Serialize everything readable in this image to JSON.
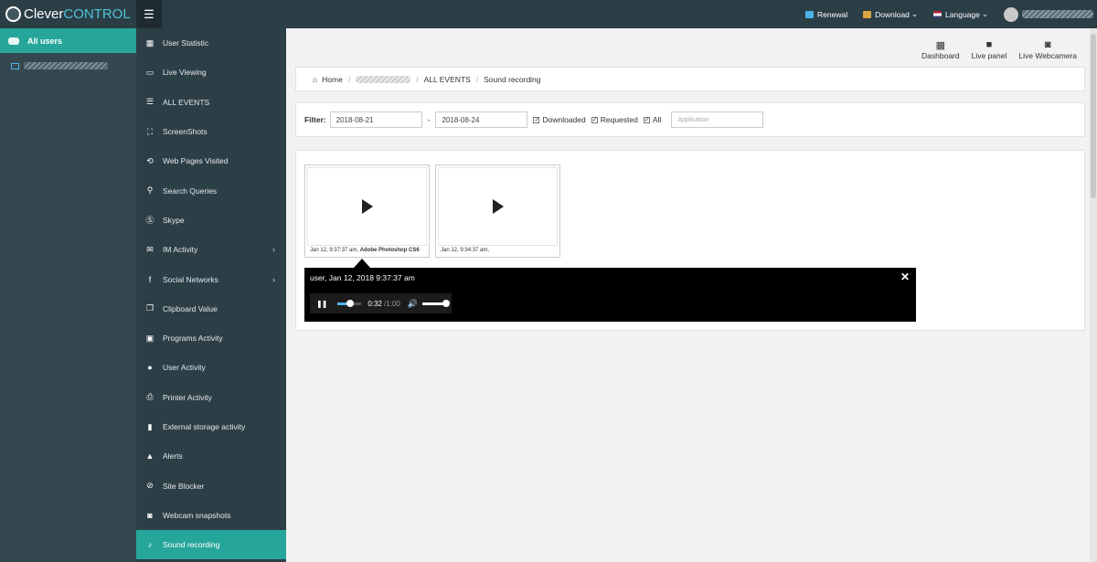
{
  "app": {
    "brand_a": "Clever",
    "brand_b": "CONTROL"
  },
  "topbar": {
    "renewal": "Renewal",
    "download": "Download",
    "language": "Language",
    "caret": "⌄"
  },
  "sidebar": {
    "all_users": "All users"
  },
  "nav": [
    {
      "label": "User Statistic",
      "icon": "grid-icon",
      "glyph": "▦",
      "chevron": ""
    },
    {
      "label": "Live Viewing",
      "icon": "monitor-icon",
      "glyph": "▭",
      "chevron": ""
    },
    {
      "label": "ALL EVENTS",
      "icon": "list-icon",
      "glyph": "☰",
      "chevron": ""
    },
    {
      "label": "ScreenShots",
      "icon": "screenshot-icon",
      "glyph": "⛶",
      "chevron": ""
    },
    {
      "label": "Web Pages Visited",
      "icon": "history-icon",
      "glyph": "⟲",
      "chevron": ""
    },
    {
      "label": "Search Queries",
      "icon": "search-icon",
      "glyph": "⚲",
      "chevron": ""
    },
    {
      "label": "Skype",
      "icon": "skype-icon",
      "glyph": "Ⓢ",
      "chevron": ""
    },
    {
      "label": "IM Activity",
      "icon": "chat-icon",
      "glyph": "✉",
      "chevron": "›"
    },
    {
      "label": "Social Networks",
      "icon": "facebook-icon",
      "glyph": "f",
      "chevron": "›"
    },
    {
      "label": "Clipboard Value",
      "icon": "clipboard-icon",
      "glyph": "❐",
      "chevron": ""
    },
    {
      "label": "Programs Activity",
      "icon": "save-icon",
      "glyph": "▣",
      "chevron": ""
    },
    {
      "label": "User Activity",
      "icon": "user-icon",
      "glyph": "●",
      "chevron": ""
    },
    {
      "label": "Printer Activity",
      "icon": "printer-icon",
      "glyph": "⎙",
      "chevron": ""
    },
    {
      "label": "External storage activity",
      "icon": "usb-icon",
      "glyph": "▮",
      "chevron": ""
    },
    {
      "label": "Alerts",
      "icon": "alert-icon",
      "glyph": "▲",
      "chevron": ""
    },
    {
      "label": "Site Blocker",
      "icon": "block-icon",
      "glyph": "⊘",
      "chevron": ""
    },
    {
      "label": "Webcam snapshots",
      "icon": "camera-icon",
      "glyph": "◙",
      "chevron": ""
    },
    {
      "label": "Sound recording",
      "icon": "microphone-icon",
      "glyph": "♪",
      "chevron": ""
    }
  ],
  "quicklinks": [
    {
      "label": "Dashboard",
      "icon": "dashboard-icon",
      "glyph": "▦"
    },
    {
      "label": "Live panel",
      "icon": "video-icon",
      "glyph": "■"
    },
    {
      "label": "Live Webcamera",
      "icon": "camera-icon",
      "glyph": "◙"
    }
  ],
  "breadcrumb": {
    "home": "Home",
    "sep": "/",
    "events": "ALL EVENTS",
    "current": "Sound recording"
  },
  "filter": {
    "label": "Filter:",
    "date_from": "2018-08-21",
    "dash": "-",
    "date_to": "2018-08-24",
    "downloaded": "Downloaded",
    "requested": "Requested",
    "all": "All",
    "check": "✓",
    "application_placeholder": "Application"
  },
  "recordings": [
    {
      "time": "Jan 12, 9:37:37 am,",
      "app": "Adobe Photoshop CS6"
    },
    {
      "time": "Jan 12, 9:34:37 am,",
      "app": ""
    }
  ],
  "player": {
    "title": "user, Jan 12, 2018 9:37:37 am",
    "close": "✕",
    "pause_glyph": "❚❚",
    "current": "0:32",
    "sep": " / ",
    "duration": "1:00",
    "progress": 0.53,
    "volume": 1.0,
    "volume_glyph": "🔊"
  },
  "colors": {
    "accent": "#26a69a",
    "topbar": "#2b3e46",
    "nav_bg": "#2d3f46",
    "users_bg": "#36484f"
  }
}
